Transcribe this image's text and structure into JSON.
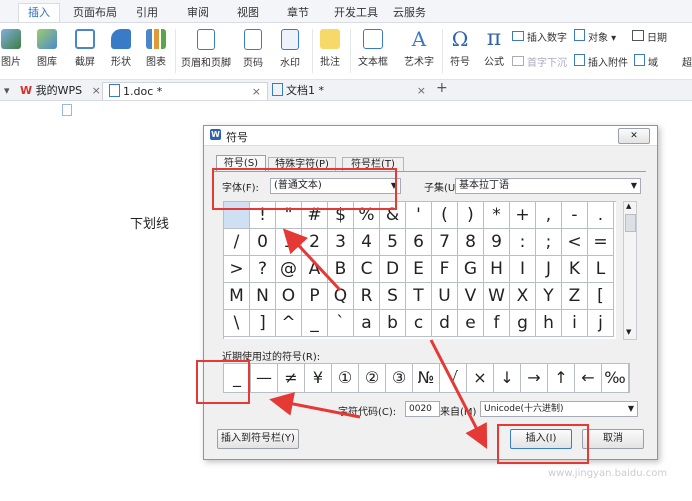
{
  "menu": {
    "tabs": [
      "插入",
      "页面布局",
      "引用",
      "审阅",
      "视图",
      "章节",
      "开发工具",
      "云服务"
    ]
  },
  "toolbar": {
    "items": [
      "图片",
      "图库",
      "截屏",
      "形状",
      "图表",
      "页眉和页脚",
      "页码",
      "水印",
      "批注",
      "文本框",
      "艺术字",
      "符号",
      "公式"
    ],
    "small": [
      "插入数字",
      "对象",
      "日期",
      "首字下沉",
      "插入附件",
      "域",
      "超"
    ]
  },
  "tabs": {
    "wps": "我的WPS",
    "doc1": "1.doc *",
    "doc2": "文档1 *",
    "add": "+",
    "close": "×"
  },
  "doc": {
    "text": "下划线"
  },
  "dialog": {
    "title": "符号",
    "close": "✕",
    "tabs": [
      "符号(S)",
      "特殊字符(P)",
      "符号栏(T)"
    ],
    "font_label": "字体(F):",
    "font_value": "(普通文本)",
    "subset_label": "子集(U):",
    "subset_value": "基本拉丁语",
    "grid": [
      [
        "",
        "!",
        "\"",
        "#",
        "$",
        "%",
        "&",
        "'",
        "(",
        ")",
        "*",
        "+",
        ",",
        "-",
        "."
      ],
      [
        "/",
        "0",
        "1",
        "2",
        "3",
        "4",
        "5",
        "6",
        "7",
        "8",
        "9",
        ":",
        ";",
        "<",
        "="
      ],
      [
        ">",
        "?",
        "@",
        "A",
        "B",
        "C",
        "D",
        "E",
        "F",
        "G",
        "H",
        "I",
        "J",
        "K",
        "L"
      ],
      [
        "M",
        "N",
        "O",
        "P",
        "Q",
        "R",
        "S",
        "T",
        "U",
        "V",
        "W",
        "X",
        "Y",
        "Z",
        "["
      ],
      [
        "\\",
        "]",
        "^",
        "_",
        "`",
        "a",
        "b",
        "c",
        "d",
        "e",
        "f",
        "g",
        "h",
        "i",
        "j"
      ]
    ],
    "recent_label": "近期使用过的符号(R):",
    "recent": [
      "_",
      "—",
      "≠",
      "¥",
      "①",
      "②",
      "③",
      "№",
      "√",
      "×",
      "↓",
      "→",
      "↑",
      "←",
      "‰"
    ],
    "code_label": "字符代码(C):",
    "code_value": "0020",
    "from_label": "来自(M)",
    "from_value": "Unicode(十六进制)",
    "insert_to_bar": "插入到符号栏(Y)",
    "insert": "插入(I)",
    "cancel": "取消"
  },
  "watermark": "www.jingyan.baidu.com",
  "colors": {
    "accent": "#2b6cc4",
    "annotation": "#e53935"
  }
}
